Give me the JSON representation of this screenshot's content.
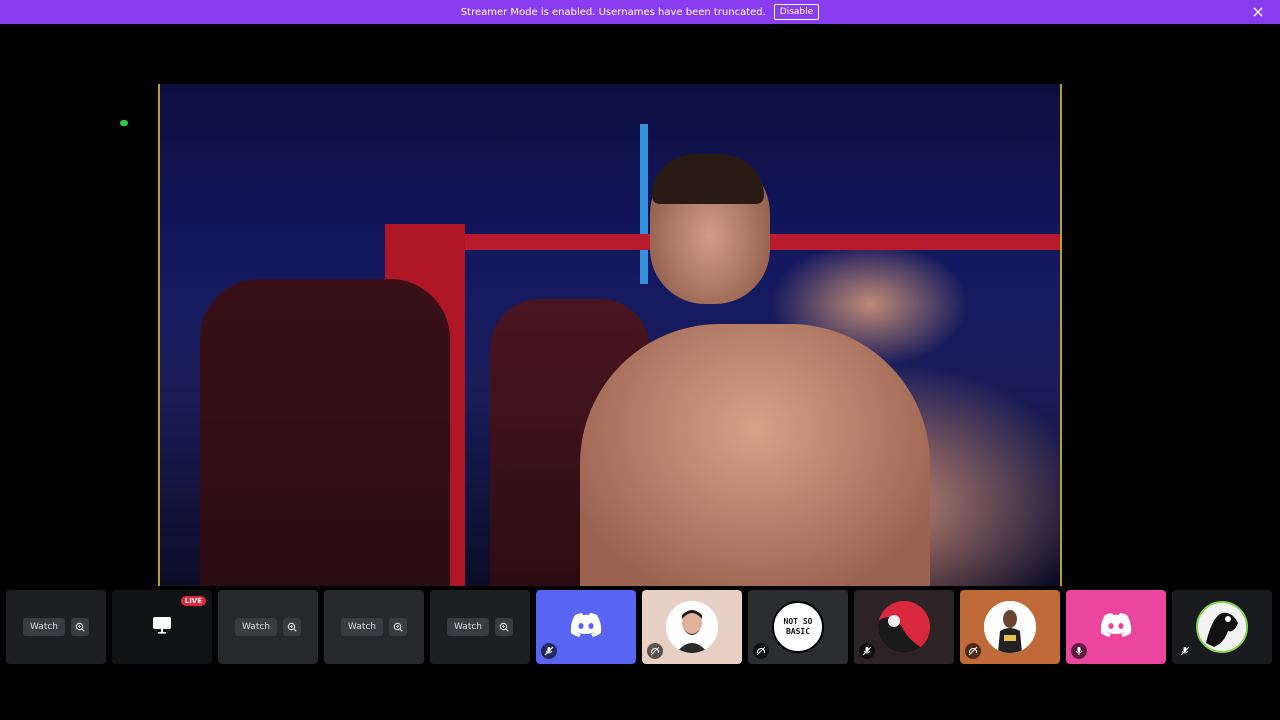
{
  "banner": {
    "message": "Streamer Mode is enabled. Usernames have been truncated.",
    "disable_label": "Disable",
    "color": "#8a3cf0"
  },
  "stage": {
    "video_description_icon": "live-stream-video",
    "border_color": "#b8a020"
  },
  "strip": {
    "watch_label": "Watch",
    "live_badge": "LIVE",
    "not_so_basic_line1": "NOT SO",
    "not_so_basic_line2": "BASIC",
    "discord_blue": "#5865f2",
    "discord_pink": "#eb459e",
    "avatar_peach": "#e8cfc4",
    "avatar_orange": "#c06a3a"
  }
}
